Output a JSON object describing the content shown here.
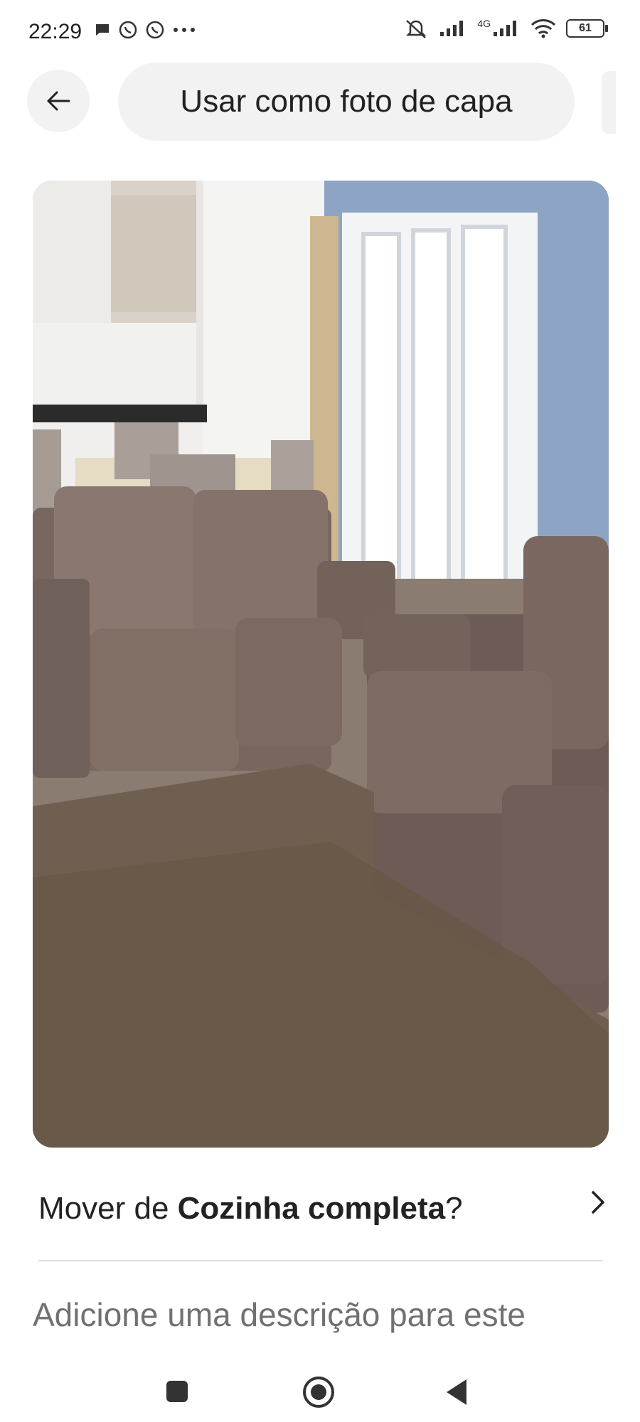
{
  "status_bar": {
    "time": "22:29",
    "network_label": "4G",
    "battery": "61"
  },
  "header": {
    "cover_photo_button": "Usar como foto de capa"
  },
  "photo": {
    "subject": "living-room-photo"
  },
  "move": {
    "prefix": "Mover de ",
    "room": "Cozinha completa",
    "suffix": "?"
  },
  "description": {
    "placeholder": "Adicione uma descrição para este"
  },
  "colors": {
    "chip_bg": "#f2f2f2",
    "text": "#222222",
    "muted_text": "#717171",
    "divider": "#dddddd"
  }
}
